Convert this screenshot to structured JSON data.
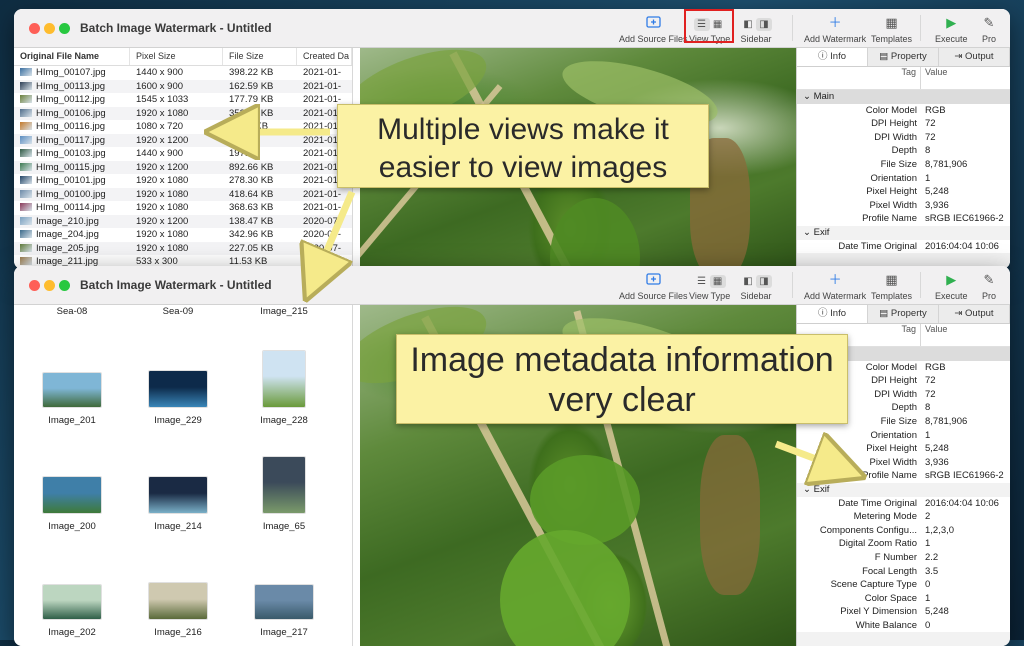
{
  "window1": {
    "title": "Batch Image Watermark - Untitled",
    "toolbar": {
      "add_source": "Add Source Files",
      "view_type": "View Type",
      "sidebar": "Sidebar",
      "add_watermark": "Add Watermark",
      "templates": "Templates",
      "execute": "Execute",
      "pro": "Pro"
    },
    "list_headers": [
      "Original File Name",
      "Pixel Size",
      "File Size",
      "Created Da"
    ],
    "rows": [
      {
        "name": "HImg_00107.jpg",
        "pixel": "1440 x 900",
        "size": "398.22 KB",
        "created": "2021-01-",
        "color": "#3b6fa0"
      },
      {
        "name": "HImg_00113.jpg",
        "pixel": "1600 x 900",
        "size": "162.59 KB",
        "created": "2021-01-",
        "color": "#2c3e55"
      },
      {
        "name": "HImg_00112.jpg",
        "pixel": "1545 x 1033",
        "size": "177.79 KB",
        "created": "2021-01-",
        "color": "#6a7f3a"
      },
      {
        "name": "HImg_00106.jpg",
        "pixel": "1920 x 1080",
        "size": "352.49 KB",
        "created": "2021-01-",
        "color": "#4f6c8a"
      },
      {
        "name": "HImg_00116.jpg",
        "pixel": "1080 x 720",
        "size": "87.73 KB",
        "created": "2021-01-",
        "color": "#c47a2a"
      },
      {
        "name": "HImg_00117.jpg",
        "pixel": "1920 x 1200",
        "size": "",
        "created": "2021-01-",
        "color": "#5a8cc0"
      },
      {
        "name": "HImg_00103.jpg",
        "pixel": "1440 x 900",
        "size": "197.8",
        "created": "2021-01-",
        "color": "#2f5a44"
      },
      {
        "name": "HImg_00115.jpg",
        "pixel": "1920 x 1200",
        "size": "892.66 KB",
        "created": "2021-01-",
        "color": "#3d7a52"
      },
      {
        "name": "HImg_00101.jpg",
        "pixel": "1920 x 1080",
        "size": "278.30 KB",
        "created": "2021-01-",
        "color": "#224466"
      },
      {
        "name": "HImg_00100.jpg",
        "pixel": "1920 x 1080",
        "size": "418.64 KB",
        "created": "2021-01-",
        "color": "#6d8aa8"
      },
      {
        "name": "HImg_00114.jpg",
        "pixel": "1920 x 1080",
        "size": "368.63 KB",
        "created": "2021-01-",
        "color": "#8a3a5a"
      },
      {
        "name": "Image_210.jpg",
        "pixel": "1920 x 1200",
        "size": "138.47 KB",
        "created": "2020-07-",
        "color": "#7aa0c0"
      },
      {
        "name": "Image_204.jpg",
        "pixel": "1920 x 1080",
        "size": "342.96 KB",
        "created": "2020-07-",
        "color": "#3a6a8a"
      },
      {
        "name": "Image_205.jpg",
        "pixel": "1920 x 1080",
        "size": "227.05 KB",
        "created": "2020-07-",
        "color": "#5f7a3a"
      },
      {
        "name": "Image_211.jpg",
        "pixel": "533 x 300",
        "size": "11.53 KB",
        "created": "2020-07-",
        "color": "#9a7a4a"
      }
    ],
    "inspector_tabs": [
      "Info",
      "Property",
      "Output"
    ],
    "col_tag": "Tag",
    "col_value": "Value",
    "section_main": "Main",
    "section_exif": "Exif",
    "main_items": [
      {
        "k": "Color Model",
        "v": "RGB"
      },
      {
        "k": "DPI Height",
        "v": "72"
      },
      {
        "k": "DPI Width",
        "v": "72"
      },
      {
        "k": "Depth",
        "v": "8"
      },
      {
        "k": "File Size",
        "v": "8,781,906"
      },
      {
        "k": "Orientation",
        "v": "1"
      },
      {
        "k": "Pixel Height",
        "v": "5,248"
      },
      {
        "k": "Pixel Width",
        "v": "3,936"
      },
      {
        "k": "Profile Name",
        "v": "sRGB IEC61966-2"
      }
    ],
    "exif_items": [
      {
        "k": "Date Time Original",
        "v": "2016:04:04 10:06"
      }
    ]
  },
  "window2": {
    "title": "Batch Image Watermark - Untitled",
    "top_labels": [
      "Sea-08",
      "Sea-09",
      "Image_215"
    ],
    "grid": [
      {
        "name": "Image_201",
        "w": 58,
        "h": 34,
        "c1": "#7fb6d6",
        "c2": "#3f6a3a"
      },
      {
        "name": "Image_229",
        "w": 58,
        "h": 36,
        "c1": "#0d2a4a",
        "c2": "#3a86b8"
      },
      {
        "name": "Image_228",
        "w": 42,
        "h": 56,
        "c1": "#cfe3f2",
        "c2": "#6a9a3a"
      },
      {
        "name": "Image_200",
        "w": 58,
        "h": 36,
        "c1": "#3f7fa8",
        "c2": "#3e7a3a"
      },
      {
        "name": "Image_214",
        "w": 58,
        "h": 36,
        "c1": "#1a2a44",
        "c2": "#7ab0c8"
      },
      {
        "name": "Image_65",
        "w": 42,
        "h": 56,
        "c1": "#3b4a5a",
        "c2": "#7a9a6a"
      },
      {
        "name": "Image_202",
        "w": 58,
        "h": 34,
        "c1": "#bcd6c0",
        "c2": "#2f5f48"
      },
      {
        "name": "Image_216",
        "w": 58,
        "h": 36,
        "c1": "#cfc9b0",
        "c2": "#5a6a3a"
      },
      {
        "name": "Image_217",
        "w": 58,
        "h": 34,
        "c1": "#6a8aa8",
        "c2": "#3a5a6a"
      }
    ],
    "main_items": [
      {
        "k": "Color Model",
        "v": "RGB"
      },
      {
        "k": "DPI Height",
        "v": "72"
      },
      {
        "k": "DPI Width",
        "v": "72"
      },
      {
        "k": "Depth",
        "v": "8"
      },
      {
        "k": "File Size",
        "v": "8,781,906"
      },
      {
        "k": "Orientation",
        "v": "1"
      },
      {
        "k": "Pixel Height",
        "v": "5,248"
      },
      {
        "k": "Pixel Width",
        "v": "3,936"
      },
      {
        "k": "Profile Name",
        "v": "sRGB IEC61966-2"
      }
    ],
    "exif_items": [
      {
        "k": "Date Time Original",
        "v": "2016:04:04 10:06"
      },
      {
        "k": "Metering Mode",
        "v": "2"
      },
      {
        "k": "Components Configu...",
        "v": "1,2,3,0"
      },
      {
        "k": "Digital Zoom Ratio",
        "v": "1"
      },
      {
        "k": "F Number",
        "v": "2.2"
      },
      {
        "k": "Focal Length",
        "v": "3.5"
      },
      {
        "k": "Scene Capture Type",
        "v": "0"
      },
      {
        "k": "Color Space",
        "v": "1"
      },
      {
        "k": "Pixel Y Dimension",
        "v": "5,248"
      },
      {
        "k": "White Balance",
        "v": "0"
      }
    ]
  },
  "callouts": {
    "views": "Multiple views make it easier to view images",
    "views_line1": "Multiple views make it",
    "views_line2": "easier to view images",
    "metadata_line1": "Image metadata information",
    "metadata_line2": "very clear"
  },
  "colors": {
    "highlight_border": "#e02020",
    "callout_bg": "#fbf2a4",
    "accent_blue": "#2f7be6",
    "execute_green": "#30b050"
  }
}
